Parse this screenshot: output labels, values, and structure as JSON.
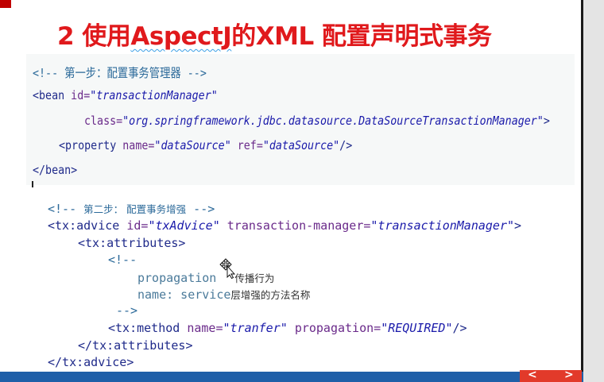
{
  "slide": {
    "title_prefix": "2 使用",
    "title_underlined": "AspectJ",
    "title_suffix": "的XML 配置声明式事务"
  },
  "block1": {
    "comment": "<!-- 第一步：配置事务管理器 -->",
    "bean_open": "<bean",
    "bean_id_attr": "id=",
    "bean_id_val": "\"transactionManager\"",
    "class_attr": "class=",
    "class_val": "\"org.springframework.jdbc.datasource.DataSourceTransactionManager\"",
    "class_close": ">",
    "prop_open": "<property",
    "prop_name_attr": "name=",
    "prop_name_val": "\"dataSource\"",
    "prop_ref_attr": "ref=",
    "prop_ref_val": "\"dataSource\"",
    "prop_close": "/>",
    "bean_close": "</bean>"
  },
  "block2": {
    "comment_open": "<!-- ",
    "comment_text": "第二步： 配置事务增强",
    "comment_close": " -->",
    "advice_open": "<tx:advice",
    "advice_id_attr": "id=",
    "advice_id_val": "\"txAdvice\"",
    "advice_tm_attr": "transaction-manager=",
    "advice_tm_val": "\"transactionManager\"",
    "advice_gt": ">",
    "attrs_open": "<tx:attributes>",
    "inner_comment_open": "<!--",
    "propagation_key": "propagation",
    "propagation_desc": "传播行为",
    "name_key": "name: service",
    "name_desc": "层增强的方法名称",
    "inner_comment_close": "-->",
    "method_open": "<tx:method",
    "method_name_attr": "name=",
    "method_name_val": "\"tranfer\"",
    "method_prop_attr": "propagation=",
    "method_prop_val": "\"REQUIRED\"",
    "method_close": "/>",
    "attrs_close": "</tx:attributes>",
    "advice_close": "</tx:advice>"
  },
  "nav": {
    "prev": "<",
    "next": ">"
  },
  "icons": {
    "cursor": "move-cursor-icon"
  }
}
